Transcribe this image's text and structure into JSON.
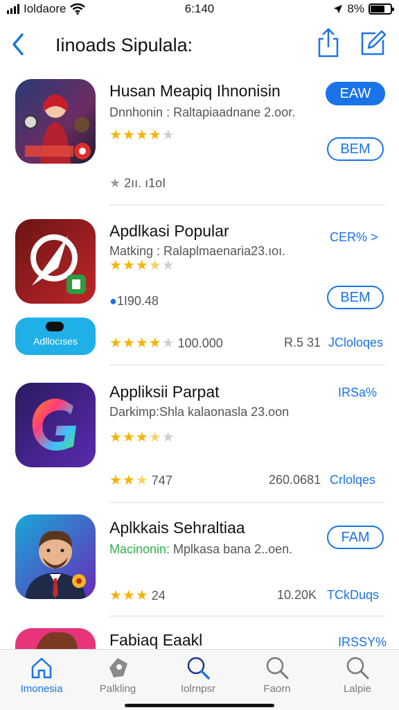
{
  "status": {
    "carrier": "Ioldaore",
    "time": "6:140",
    "battery": "8%"
  },
  "nav": {
    "title": "Iinoads Sipulala:"
  },
  "apps": [
    {
      "name": "Husan Meapiq Ihnonisin",
      "subtitle": "Dnnhonin : Raltapiaadnane 2.oor.",
      "rating": 4,
      "primary_button": "EAW",
      "secondary_button": "BEM",
      "extra_meta": "2ıı. ı1oI",
      "icon": "game-character-icon"
    },
    {
      "name": "Apdlkasi Popular",
      "subtitle": "Matking : Ralaplmaenaria23.ıoı.",
      "rating": 3.5,
      "price_link": "CER% >",
      "secondary_button": "BEM",
      "info_text": "1I90.48",
      "badge_label": "Adllocıses",
      "row2_rating": 4,
      "row2_count": "100.000",
      "row2_price": "R.5 31",
      "row2_link": "JCloloqes",
      "icon": "compass-app-icon"
    },
    {
      "name": "Appliksii Parpat",
      "subtitle": "Darkimp:Shla kalaonasla 23.oon",
      "rating": 3.5,
      "price_link": "IRSa%",
      "row2_rating": 2.5,
      "row2_count": "747",
      "row2_price": "260.0681",
      "row2_link": "Crlolqes",
      "icon": "colorful-g-icon"
    },
    {
      "name": "Aplkkais Sehraltiaa",
      "subtitle_green": "Macinonin:",
      "subtitle": " Mplkasa bana 2..oen.",
      "primary_button": "FAM",
      "row2_rating": 3,
      "row2_count": "24",
      "row2_price": "10.20K",
      "row2_link": "TCkDuqs",
      "icon": "avatar-man-icon"
    },
    {
      "name": "Fabiaq Eaakl",
      "price_link": "IRSSY%",
      "icon": "partial-app-icon"
    }
  ],
  "tabs": [
    {
      "label": "Imonesia",
      "icon": "home-icon"
    },
    {
      "label": "Palkling",
      "icon": "tag-icon"
    },
    {
      "label": "Iolrnpsr",
      "icon": "search-icon"
    },
    {
      "label": "Faorn",
      "icon": "search-icon"
    },
    {
      "label": "Lalpie",
      "icon": "search-icon"
    }
  ],
  "colors": {
    "accent": "#1a73e8",
    "star": "#f5b400",
    "green": "#2eb34b"
  }
}
